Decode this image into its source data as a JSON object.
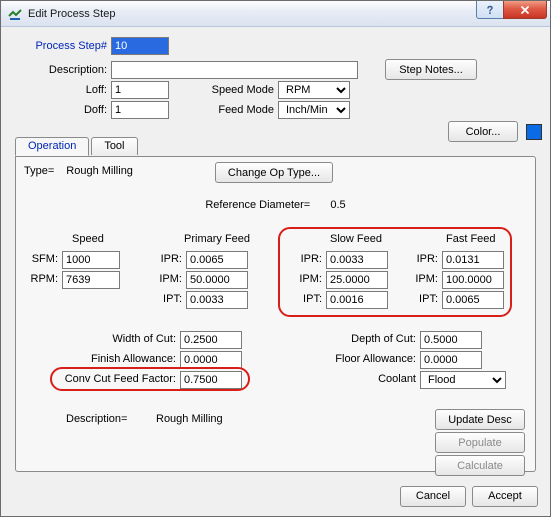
{
  "window": {
    "title": "Edit Process Step"
  },
  "header": {
    "processStepLabel": "Process Step#",
    "processStepValue": "10",
    "descriptionLabel": "Description:",
    "descriptionValue": "",
    "stepNotes": "Step Notes...",
    "loffLabel": "Loff:",
    "loffValue": "1",
    "doffLabel": "Doff:",
    "doffValue": "1",
    "speedModeLabel": "Speed Mode",
    "speedModeValue": "RPM",
    "feedModeLabel": "Feed Mode",
    "feedModeValue": "Inch/Min",
    "colorBtn": "Color..."
  },
  "tabs": {
    "operation": "Operation",
    "tool": "Tool"
  },
  "op": {
    "typeLabel": "Type=",
    "typeValue": "Rough Milling",
    "changeOpType": "Change Op Type...",
    "refDiamLabel": "Reference Diameter=",
    "refDiamValue": "0.5",
    "speedHdr": "Speed",
    "primaryFeedHdr": "Primary Feed",
    "slowFeedHdr": "Slow Feed",
    "fastFeedHdr": "Fast Feed",
    "sfmLabel": "SFM:",
    "sfmValue": "1000",
    "rpmLabel": "RPM:",
    "rpmValue": "7639",
    "ipr1Label": "IPR:",
    "ipr1Value": "0.0065",
    "ipm1Label": "IPM:",
    "ipm1Value": "50.0000",
    "ipt1Label": "IPT:",
    "ipt1Value": "0.0033",
    "ipr2Label": "IPR:",
    "ipr2Value": "0.0033",
    "ipm2Label": "IPM:",
    "ipm2Value": "25.0000",
    "ipt2Label": "IPT:",
    "ipt2Value": "0.0016",
    "ipr3Label": "IPR:",
    "ipr3Value": "0.0131",
    "ipm3Label": "IPM:",
    "ipm3Value": "100.0000",
    "ipt3Label": "IPT:",
    "ipt3Value": "0.0065",
    "widthCutLabel": "Width of Cut:",
    "widthCutValue": "0.2500",
    "finishAllowLabel": "Finish Allowance:",
    "finishAllowValue": "0.0000",
    "convCutLabel": "Conv Cut Feed Factor:",
    "convCutValue": "0.7500",
    "depthCutLabel": "Depth of Cut:",
    "depthCutValue": "0.5000",
    "floorAllowLabel": "Floor Allowance:",
    "floorAllowValue": "0.0000",
    "coolantLabel": "Coolant",
    "coolantValue": "Flood",
    "desc2Label": "Description=",
    "desc2Value": "Rough Milling",
    "updateDesc": "Update Desc",
    "populate": "Populate",
    "calculate": "Calculate"
  },
  "footer": {
    "cancel": "Cancel",
    "accept": "Accept"
  }
}
